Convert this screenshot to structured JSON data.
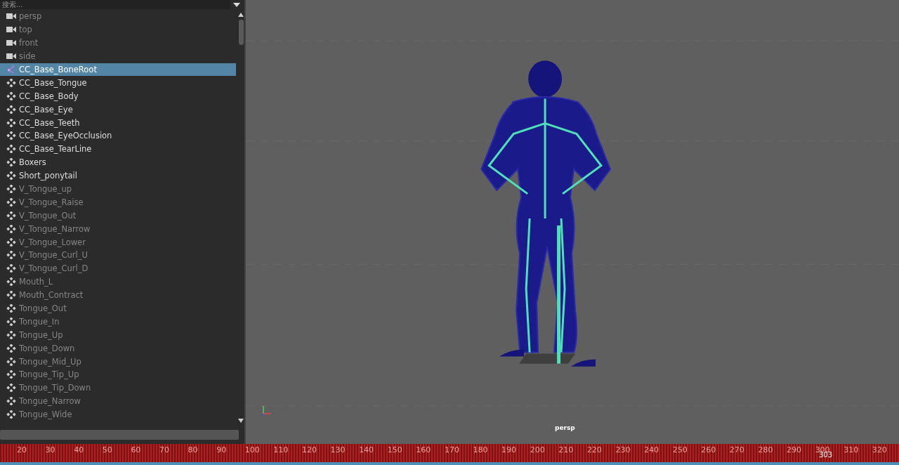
{
  "outliner": {
    "search": {
      "placeholder": "搜索..."
    },
    "items": [
      {
        "label": "persp",
        "kind": "camera",
        "selected": false,
        "dimmed": true
      },
      {
        "label": "top",
        "kind": "camera",
        "selected": false,
        "dimmed": true
      },
      {
        "label": "front",
        "kind": "camera",
        "selected": false,
        "dimmed": true
      },
      {
        "label": "side",
        "kind": "camera",
        "selected": false,
        "dimmed": true
      },
      {
        "label": "CC_Base_BoneRoot",
        "kind": "joint",
        "selected": true,
        "dimmed": false
      },
      {
        "label": "CC_Base_Tongue",
        "kind": "mesh",
        "selected": false,
        "dimmed": false
      },
      {
        "label": "CC_Base_Body",
        "kind": "mesh",
        "selected": false,
        "dimmed": false
      },
      {
        "label": "CC_Base_Eye",
        "kind": "mesh",
        "selected": false,
        "dimmed": false
      },
      {
        "label": "CC_Base_Teeth",
        "kind": "mesh",
        "selected": false,
        "dimmed": false
      },
      {
        "label": "CC_Base_EyeOcclusion",
        "kind": "mesh",
        "selected": false,
        "dimmed": false
      },
      {
        "label": "CC_Base_TearLine",
        "kind": "mesh",
        "selected": false,
        "dimmed": false
      },
      {
        "label": "Boxers",
        "kind": "mesh",
        "selected": false,
        "dimmed": false
      },
      {
        "label": "Short_ponytail",
        "kind": "mesh",
        "selected": false,
        "dimmed": false
      },
      {
        "label": "V_Tongue_up",
        "kind": "mesh",
        "selected": false,
        "dimmed": true
      },
      {
        "label": "V_Tongue_Raise",
        "kind": "mesh",
        "selected": false,
        "dimmed": true
      },
      {
        "label": "V_Tongue_Out",
        "kind": "mesh",
        "selected": false,
        "dimmed": true
      },
      {
        "label": "V_Tongue_Narrow",
        "kind": "mesh",
        "selected": false,
        "dimmed": true
      },
      {
        "label": "V_Tongue_Lower",
        "kind": "mesh",
        "selected": false,
        "dimmed": true
      },
      {
        "label": "V_Tongue_Curl_U",
        "kind": "mesh",
        "selected": false,
        "dimmed": true
      },
      {
        "label": "V_Tongue_Curl_D",
        "kind": "mesh",
        "selected": false,
        "dimmed": true
      },
      {
        "label": "Mouth_L",
        "kind": "mesh",
        "selected": false,
        "dimmed": true
      },
      {
        "label": "Mouth_Contract",
        "kind": "mesh",
        "selected": false,
        "dimmed": true
      },
      {
        "label": "Tongue_Out",
        "kind": "mesh",
        "selected": false,
        "dimmed": true
      },
      {
        "label": "Tongue_In",
        "kind": "mesh",
        "selected": false,
        "dimmed": true
      },
      {
        "label": "Tongue_Up",
        "kind": "mesh",
        "selected": false,
        "dimmed": true
      },
      {
        "label": "Tongue_Down",
        "kind": "mesh",
        "selected": false,
        "dimmed": true
      },
      {
        "label": "Tongue_Mid_Up",
        "kind": "mesh",
        "selected": false,
        "dimmed": true
      },
      {
        "label": "Tongue_Tip_Up",
        "kind": "mesh",
        "selected": false,
        "dimmed": true
      },
      {
        "label": "Tongue_Tip_Down",
        "kind": "mesh",
        "selected": false,
        "dimmed": true
      },
      {
        "label": "Tongue_Narrow",
        "kind": "mesh",
        "selected": false,
        "dimmed": true
      },
      {
        "label": "Tongue_Wide",
        "kind": "mesh",
        "selected": false,
        "dimmed": true
      }
    ]
  },
  "viewport": {
    "camera_label": "persp"
  },
  "timeline": {
    "ticks": [
      "20",
      "30",
      "40",
      "50",
      "60",
      "70",
      "80",
      "90",
      "100",
      "110",
      "120",
      "130",
      "140",
      "150",
      "160",
      "170",
      "180",
      "190",
      "200",
      "210",
      "220",
      "230",
      "240",
      "250",
      "260",
      "270",
      "280",
      "290",
      "300",
      "310",
      "320"
    ],
    "current_frame": "303"
  }
}
